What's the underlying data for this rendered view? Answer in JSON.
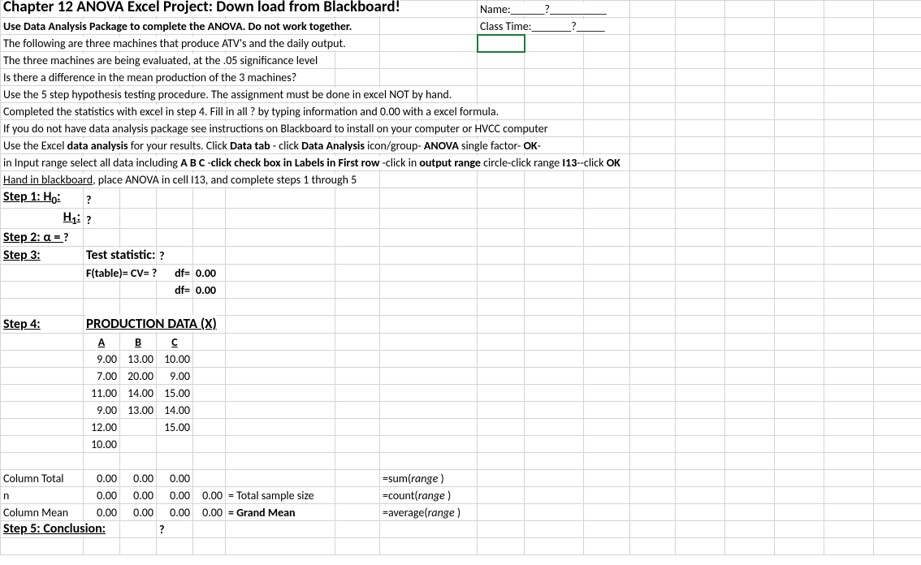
{
  "title": "Chapter 12 ANOVA Excel Project: Down load from Blackboard!",
  "namelabel": "Name:",
  "nameval": "?",
  "classtimelabel": "Class Time:",
  "classtimeval": "?",
  "sub1": "Use Data Analysis Package to complete the ANOVA. Do not work together.",
  "l3": "The following are three machines that produce ATV's and the daily output.",
  "l4": "The three machines are being evaluated, at the .05 significance level",
  "l5": "Is there a difference in the mean production of the 3 machines?",
  "l6": "Use the 5 step hypothesis testing procedure. The assignment must be done in excel NOT by hand.",
  "l7": "Completed the statistics with excel in step 4. Fill in all  ? by typing information and 0.00 with a excel formula.",
  "l8": "If you do not have data analysis package see instructions on Blackboard to install on your computer or HVCC  computer",
  "l9a": "Use the Excel ",
  "l9b": "data analysis",
  "l9c": " for your results.  Click ",
  "l9d": "Data tab",
  "l9e": " - click ",
  "l9f": "Data Analysis",
  "l9g": " icon/group- ",
  "l9h": "ANOVA",
  "l9i": " single factor- ",
  "l9j": "OK",
  "l9k": "-",
  "l10a": "   in Input range select all data including ",
  "l10b": "A B C",
  "l10c": " -",
  "l10d": "click check box in Labels in First row",
  "l10e": " -click in ",
  "l10f": "output range",
  "l10g": " circle-click range ",
  "l10h": "I13",
  "l10i": "--click ",
  "l10j": "OK",
  "l11a": "Hand in blackboard",
  "l11b": ", place ANOVA in cell I13,",
  "l11c": "  and complete steps 1 through 5",
  "step1": "Step 1: H",
  "step1sub": "0",
  "step1col": ":",
  "step1v": "?",
  "h1": "H",
  "h1sub": "1",
  "h1col": ":",
  "h1v": "?",
  "step2": "Step 2: α = ",
  "step2v": "?",
  "step3": "Step 3:",
  "teststat": "Test statistic:",
  "teststatv": "?",
  "ftable": "F(table)= CV=",
  "ftablev": "?",
  "df1lab": "df=",
  "df1v": "0.00",
  "df2lab": "df=",
  "df2v": "0.00",
  "step4": "Step 4:",
  "prodhead": "PRODUCTION DATA (X)",
  "colA": "A",
  "colB": "B",
  "colC": "C",
  "data": [
    [
      "9.00",
      "13.00",
      "10.00"
    ],
    [
      "7.00",
      "20.00",
      "9.00"
    ],
    [
      "11.00",
      "14.00",
      "15.00"
    ],
    [
      "9.00",
      "13.00",
      "14.00"
    ],
    [
      "12.00",
      "",
      "15.00"
    ],
    [
      "10.00",
      "",
      ""
    ]
  ],
  "coltot": "Column Total",
  "zeroA": "0.00",
  "zeroB": "0.00",
  "zeroC": "0.00",
  "nlbl": "n",
  "nA": "0.00",
  "nB": "0.00",
  "nC": "0.00",
  "nD": "0.00",
  "tss": "= Total sample size",
  "cmean": "Column Mean",
  "mA": "0.00",
  "mB": "0.00",
  "mC": "0.00",
  "mD": "0.00",
  "gm": "= Grand Mean",
  "fsum": "=sum(",
  "fcount": "=count(",
  "favg": "=average(",
  "frange": "range",
  "fclose": " )",
  "step5": "Step 5: Conclusion:",
  "step5v": "?",
  "chart_data": {
    "type": "table",
    "title": "PRODUCTION DATA (X)",
    "columns": [
      "A",
      "B",
      "C"
    ],
    "rows": [
      [
        9.0,
        13.0,
        10.0
      ],
      [
        7.0,
        20.0,
        9.0
      ],
      [
        11.0,
        14.0,
        15.0
      ],
      [
        9.0,
        13.0,
        14.0
      ],
      [
        12.0,
        null,
        15.0
      ],
      [
        10.0,
        null,
        null
      ]
    ],
    "column_total": [
      0.0,
      0.0,
      0.0
    ],
    "n": [
      0.0,
      0.0,
      0.0
    ],
    "total_sample_size": 0.0,
    "column_mean": [
      0.0,
      0.0,
      0.0
    ],
    "grand_mean": 0.0
  }
}
